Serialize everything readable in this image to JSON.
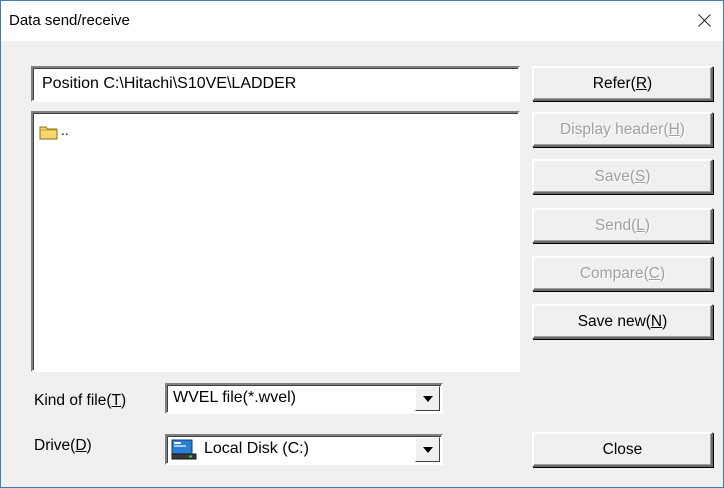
{
  "window": {
    "title": "Data send/receive",
    "close_icon": "close-icon"
  },
  "position": {
    "text": "Position C:\\Hitachi\\S10VE\\LADDER"
  },
  "file_list": {
    "items": [
      {
        "icon": "folder-icon",
        "label": ".."
      }
    ]
  },
  "buttons": {
    "refer": {
      "label": "Refer(",
      "key": "R",
      "suffix": ")",
      "enabled": true
    },
    "display_header": {
      "label": "Display header(",
      "key": "H",
      "suffix": ")",
      "enabled": false
    },
    "save": {
      "label": "Save(",
      "key": "S",
      "suffix": ")",
      "enabled": false
    },
    "send": {
      "label": "Send(",
      "key": "L",
      "suffix": ")",
      "enabled": false
    },
    "compare": {
      "label": "Compare(",
      "key": "C",
      "suffix": ")",
      "enabled": false
    },
    "save_new": {
      "label": "Save new(",
      "key": "N",
      "suffix": ")",
      "enabled": true
    },
    "close": {
      "label": "Close",
      "enabled": true
    }
  },
  "kind_of_file": {
    "label": "Kind of file(",
    "key": "T",
    "suffix": ")",
    "value": "WVEL file(*.wvel)"
  },
  "drive": {
    "label": "Drive(",
    "key": "D",
    "suffix": ")",
    "value": "Local Disk (C:)",
    "icon": "hard-drive-icon"
  },
  "colors": {
    "window_border": "#3c7fb1",
    "dialog_bg": "#f0f0f0",
    "disabled_text": "#a0a0a0",
    "folder_yellow": "#f5d76e"
  }
}
